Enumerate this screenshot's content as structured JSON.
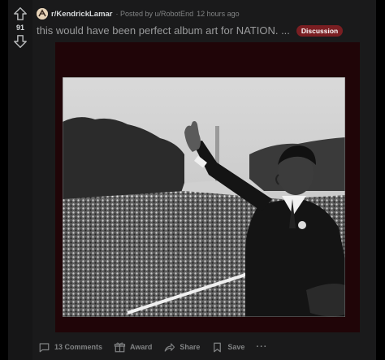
{
  "post": {
    "score": "91",
    "subreddit": "r/KendrickLamar",
    "posted_by": "· Posted by u/RobotEnd",
    "age": "12 hours ago",
    "title": "this would have been perfect album art for NATION. ...",
    "flair": "Discussion"
  },
  "actions": {
    "comments": "13 Comments",
    "award": "Award",
    "share": "Share",
    "save": "Save",
    "more": "···"
  },
  "colors": {
    "background": "#000000",
    "card": "#1a1a1b",
    "flair": "#7a1e22",
    "media_frame": "#200508",
    "text_muted": "#818384",
    "text_main": "#d7dadc"
  },
  "icons": {
    "upvote": "arrow-up-icon",
    "downvote": "arrow-down-icon",
    "comments": "comment-icon",
    "award": "gift-icon",
    "share": "share-icon",
    "save": "bookmark-icon",
    "more": "more-icon"
  }
}
